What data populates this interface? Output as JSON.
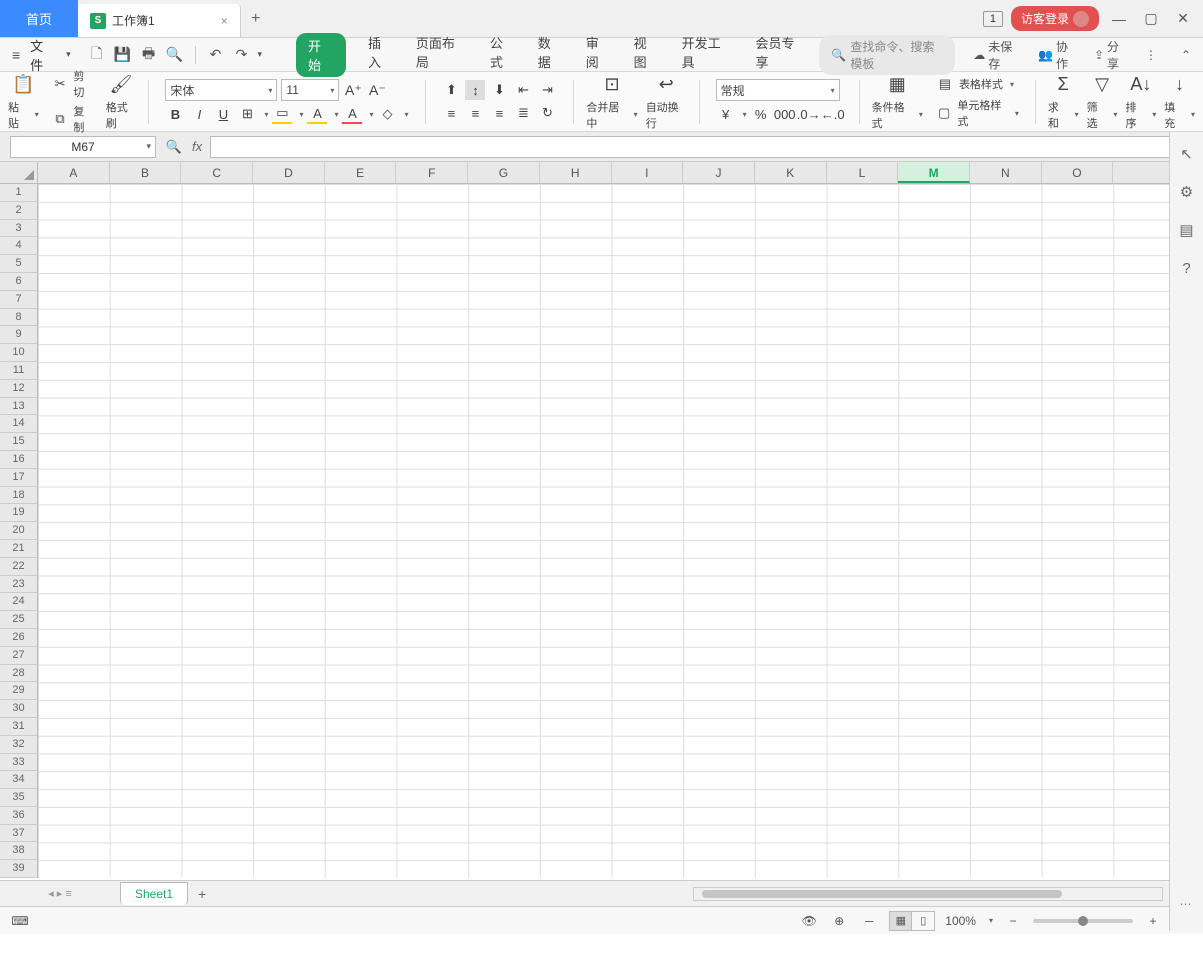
{
  "titlebar": {
    "home_tab": "首页",
    "doc_tab": "工作簿1",
    "badge": "1",
    "login": "访客登录"
  },
  "menubar": {
    "file": "文件",
    "tabs": [
      "开始",
      "插入",
      "页面布局",
      "公式",
      "数据",
      "审阅",
      "视图",
      "开发工具",
      "会员专享"
    ],
    "search_placeholder": "查找命令、搜索模板",
    "unsaved": "未保存",
    "collab": "协作",
    "share": "分享"
  },
  "ribbon": {
    "paste": "粘贴",
    "cut": "剪切",
    "copy": "复制",
    "format_painter": "格式刷",
    "font_name": "宋体",
    "font_size": "11",
    "merge_center": "合并居中",
    "auto_wrap": "自动换行",
    "number_format": "常规",
    "cond_format": "条件格式",
    "table_style": "表格样式",
    "cell_style": "单元格样式",
    "sum": "求和",
    "filter": "筛选",
    "sort": "排序",
    "fill": "填充"
  },
  "formula_bar": {
    "name_box": "M67"
  },
  "grid": {
    "columns": [
      "A",
      "B",
      "C",
      "D",
      "E",
      "F",
      "G",
      "H",
      "I",
      "J",
      "K",
      "L",
      "M",
      "N",
      "O"
    ],
    "active_column": "M",
    "row_count": 39
  },
  "sheets": {
    "active": "Sheet1"
  },
  "status": {
    "zoom": "100%"
  }
}
